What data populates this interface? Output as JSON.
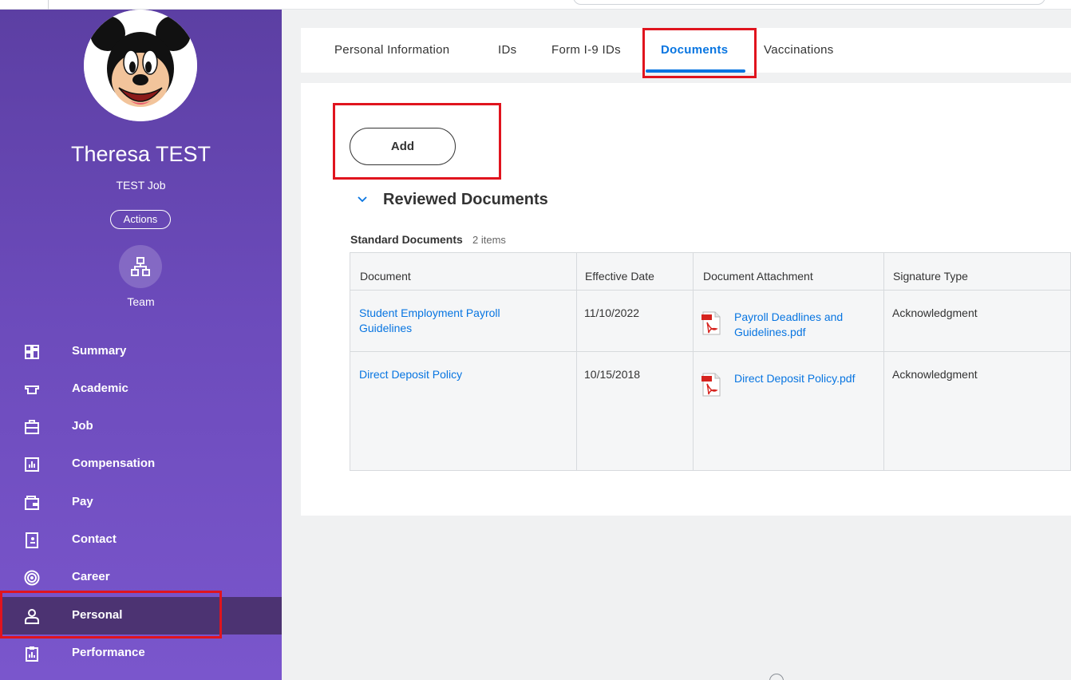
{
  "profile": {
    "name": "Theresa TEST",
    "job": "TEST Job",
    "actions_label": "Actions",
    "team_label": "Team"
  },
  "sidebar": {
    "items": [
      {
        "label": "Summary",
        "icon": "summary-grid-icon",
        "active": false
      },
      {
        "label": "Academic",
        "icon": "academic-cap-icon",
        "active": false
      },
      {
        "label": "Job",
        "icon": "briefcase-icon",
        "active": false
      },
      {
        "label": "Compensation",
        "icon": "compensation-chart-icon",
        "active": false
      },
      {
        "label": "Pay",
        "icon": "wallet-icon",
        "active": false
      },
      {
        "label": "Contact",
        "icon": "contact-book-icon",
        "active": false
      },
      {
        "label": "Career",
        "icon": "target-icon",
        "active": false
      },
      {
        "label": "Personal",
        "icon": "person-icon",
        "active": true
      },
      {
        "label": "Performance",
        "icon": "clipboard-chart-icon",
        "active": false
      }
    ]
  },
  "tabs": [
    {
      "label": "Personal Information",
      "active": false
    },
    {
      "label": "IDs",
      "active": false
    },
    {
      "label": "Form I-9 IDs",
      "active": false
    },
    {
      "label": "Documents",
      "active": true
    },
    {
      "label": "Vaccinations",
      "active": false
    }
  ],
  "main": {
    "add_label": "Add",
    "section_title": "Reviewed Documents",
    "standard_title": "Standard Documents",
    "standard_count": "2 items",
    "table": {
      "headers": [
        "Document",
        "Effective Date",
        "Document Attachment",
        "Signature Type"
      ],
      "rows": [
        {
          "document_line1": "Student Employment Payroll",
          "document_line2": "Guidelines",
          "effective_date": "11/10/2022",
          "attachment_line1": "Payroll Deadlines and",
          "attachment_line2": "Guidelines.pdf",
          "signature_type": "Acknowledgment"
        },
        {
          "document_line1": "Direct Deposit Policy",
          "document_line2": "",
          "effective_date": "10/15/2018",
          "attachment_line1": "Direct Deposit Policy.pdf",
          "attachment_line2": "",
          "signature_type": "Acknowledgment"
        }
      ]
    }
  },
  "colors": {
    "sidebar_top": "#5c3fa3",
    "sidebar_bottom": "#7a56cc",
    "active_nav": "#4c3372",
    "link_blue": "#0875e1",
    "highlight_red": "#e0141e"
  }
}
